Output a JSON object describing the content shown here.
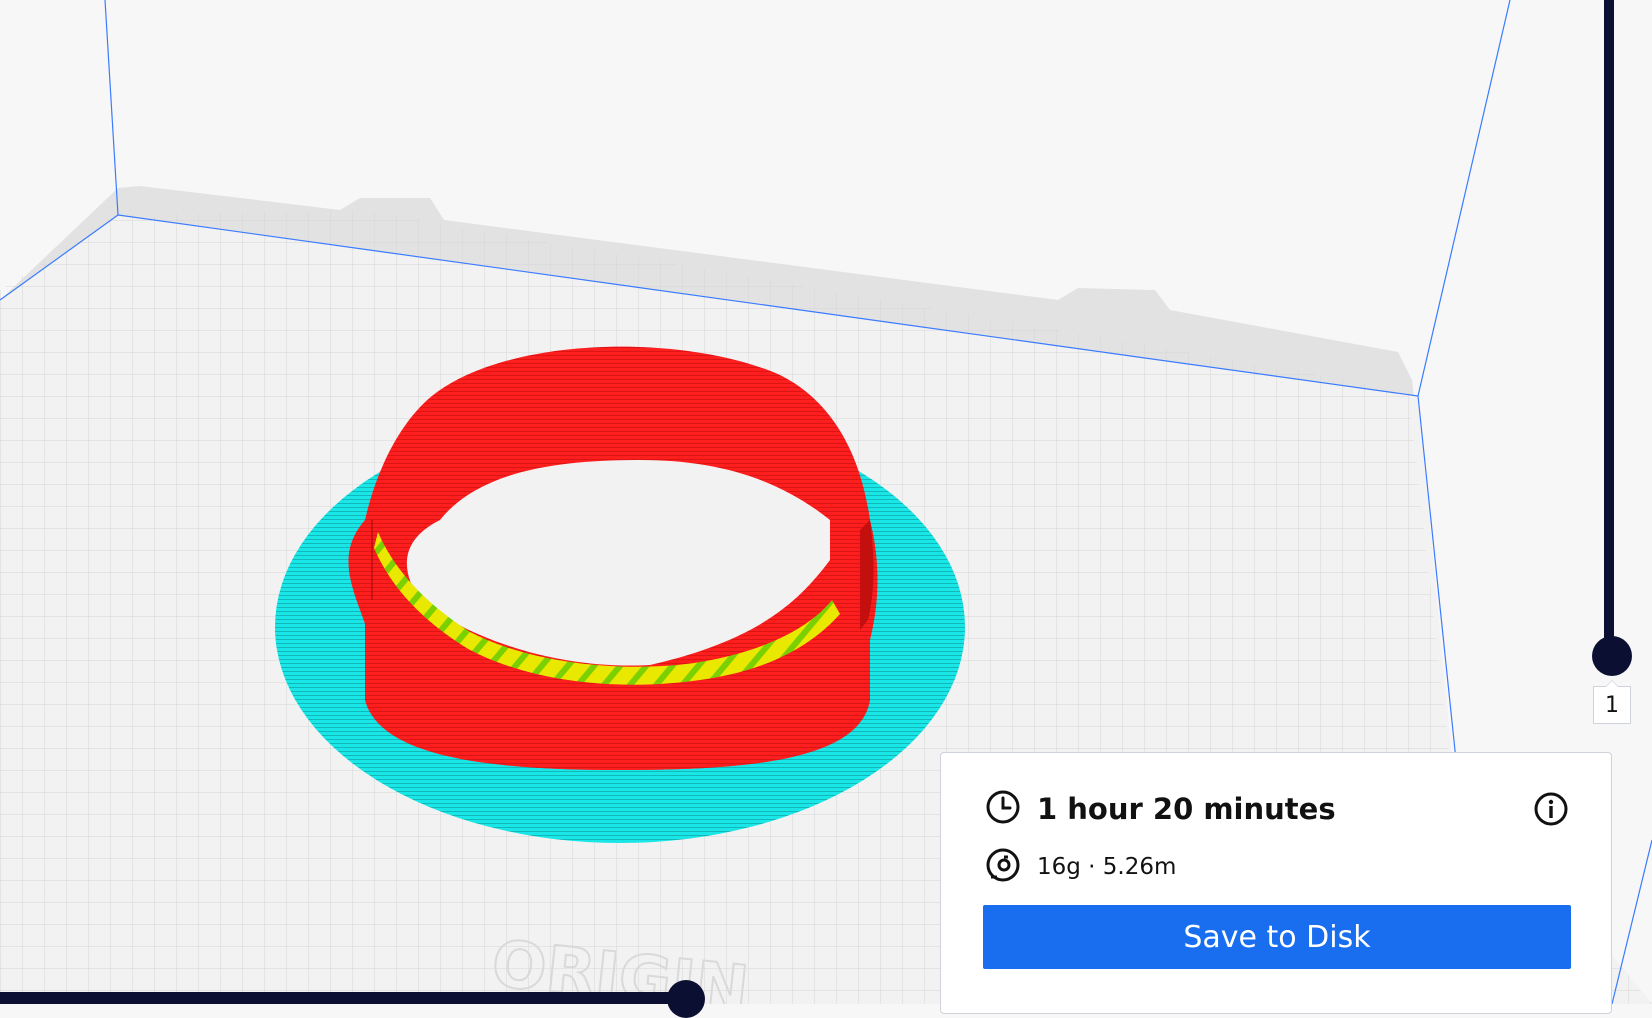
{
  "scene": {
    "bed_logo_text": "ORIGIN",
    "colors": {
      "background": "#f7f7f7",
      "bed": "#f2f2f2",
      "wall": "#ff1e1e",
      "skirt": "#19e6e6",
      "infill": "#e8e800",
      "dark_ui": "#0b1033",
      "accent": "#196ef0"
    }
  },
  "layer_slider": {
    "current_layer": "1"
  },
  "print_info": {
    "time": "1 hour 20 minutes",
    "material": "16g · 5.26m",
    "time_icon": "clock-icon",
    "material_icon": "spool-icon",
    "info_icon": "info-icon",
    "save_label": "Save to Disk"
  }
}
